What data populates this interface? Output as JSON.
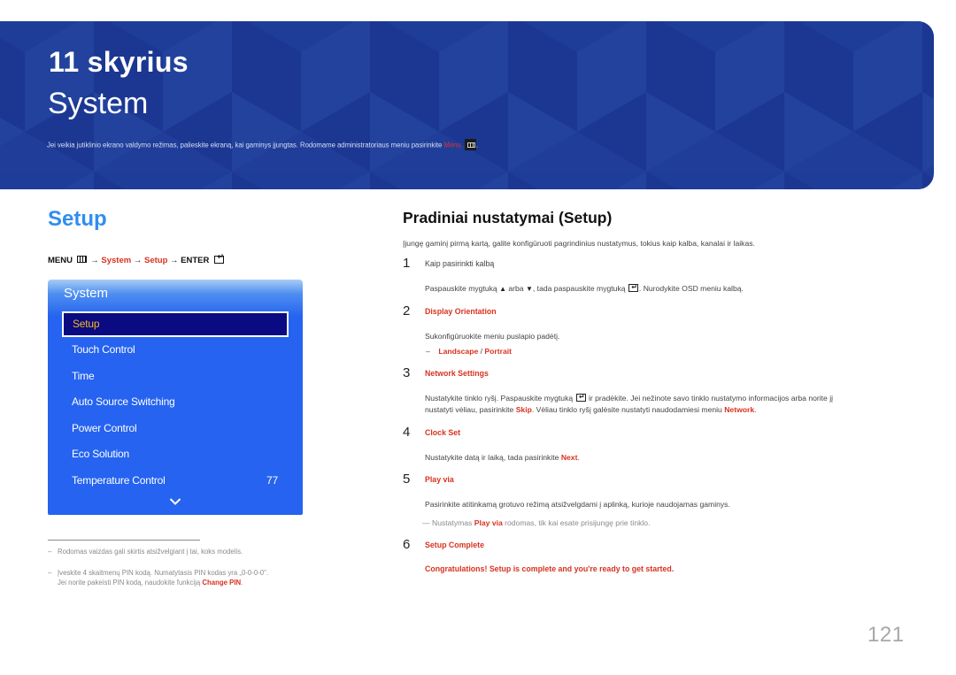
{
  "banner": {
    "chapter": "11 skyrius",
    "title": "System",
    "description_prefix": "Jei veikia jutiklinio ekrano valdymo režimas, palieskite ekraną, kai gaminys įjungtas. Rodomame administratoriaus meniu pasirinkite ",
    "description_link": "Menu",
    "description_suffix": ".",
    "menu_key_icon": "menu-key-icon",
    "colors": {
      "background": "#1e3d99",
      "link": "#e0342a"
    }
  },
  "left": {
    "section_title": "Setup",
    "breadcrumb": {
      "menu": "MENU",
      "arrow": "→",
      "items": [
        "System",
        "Setup"
      ],
      "enter": "ENTER"
    },
    "osd": {
      "title": "System",
      "items": [
        {
          "label": "Setup",
          "selected": true
        },
        {
          "label": "Touch Control"
        },
        {
          "label": "Time"
        },
        {
          "label": "Auto Source Switching"
        },
        {
          "label": "Power Control"
        },
        {
          "label": "Eco Solution"
        },
        {
          "label": "Temperature Control",
          "value": "77"
        }
      ],
      "more_icon": "chevron-down-icon",
      "colors": {
        "panel": "#2563f0",
        "selected_bg": "#0a0a82",
        "selected_text": "#f4b81c"
      }
    },
    "footnotes": [
      {
        "dash": "–",
        "text": "Rodomas vaizdas gali skirtis atsižvelgiant į tai, koks modelis."
      },
      {
        "dash": "–",
        "line1": "Įveskite 4 skaitmenų PIN kodą. Numatytasis PIN kodas yra „0-0-0-0\".",
        "line2_prefix": "Jei norite pakeisti PIN kodą, naudokite funkciją ",
        "line2_link": "Change PIN",
        "line2_suffix": "."
      }
    ]
  },
  "right": {
    "title": "Pradiniai nustatymai (Setup)",
    "intro": "Įjungę gaminį pirmą kartą, galite konfigūruoti pagrindinius nustatymus, tokius kaip kalba, kanalai ir laikas.",
    "steps": [
      {
        "num": "1",
        "heading": "Kaip pasirinkti kalbą",
        "body_a": "Paspauskite mygtuką ",
        "up": "▲",
        "body_b": " arba ",
        "down": "▼",
        "body_c": ", tada paspauskite mygtuką ",
        "body_d": ". Nurodykite OSD meniu kalbą."
      },
      {
        "num": "2",
        "heading": "Display Orientation",
        "body": "Sukonfigūruokite meniu puslapio padėtį.",
        "sub_dash": "–",
        "option_a": "Landscape",
        "sep": " / ",
        "option_b": "Portrait"
      },
      {
        "num": "3",
        "heading": "Network Settings",
        "line1_a": "Nustatykite tinklo ryšį. Paspauskite mygtuką ",
        "line1_b": " ir pradėkite. Jei nežinote savo tinklo nustatymo informacijos arba norite jį",
        "line2_a": "nustatyti vėliau, pasirinkite ",
        "skip": "Skip",
        "line2_b": ". Vėliau tinklo ryšį galėsite nustatyti naudodamiesi meniu ",
        "network": "Network",
        "line2_c": "."
      },
      {
        "num": "4",
        "heading": "Clock Set",
        "body_a": "Nustatykite datą ir laiką, tada pasirinkite ",
        "next": "Next",
        "body_b": "."
      },
      {
        "num": "5",
        "heading": "Play via",
        "body": "Pasirinkite atitinkamą grotuvo režimą atsižvelgdami į aplinką, kurioje naudojamas gaminys.",
        "note_dash": "—",
        "note_a": " Nustatymas ",
        "note_link": "Play via",
        "note_b": " rodomas, tik kai esate prisijungę prie tinklo."
      },
      {
        "num": "6",
        "heading": "Setup Complete",
        "body": "Congratulations! Setup is complete and you're ready to get started."
      }
    ],
    "accent_color": "#d8321f"
  },
  "page_number": "121"
}
